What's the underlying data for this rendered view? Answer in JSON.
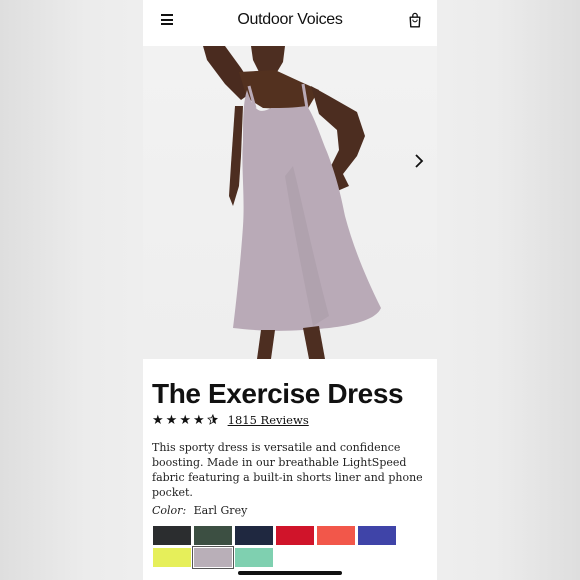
{
  "header": {
    "brand": "Outdoor Voices",
    "menu_icon": "hamburger-icon",
    "bag_icon": "shopping-bag-icon"
  },
  "hero": {
    "next_icon": "chevron-right-icon"
  },
  "product": {
    "title": "The Exercise Dress",
    "rating": 4.5,
    "reviews": "1815 Reviews",
    "description": "This sporty dress is versatile and confidence boosting. Made in our breathable LightSpeed fabric featuring a built-in shorts liner and phone pocket.",
    "color_label": "Color:",
    "color_value": "Earl Grey"
  },
  "swatches": [
    {
      "color": "#2b2d2f"
    },
    {
      "color": "#3c4f42"
    },
    {
      "color": "#1f2840"
    },
    {
      "color": "#d0142a"
    },
    {
      "color": "#f2574a"
    },
    {
      "color": "#3f44a8"
    },
    {
      "color": "#e6ef5a"
    },
    {
      "color": "#b9afb8",
      "selected": true
    },
    {
      "color": "#7fd0b0"
    }
  ]
}
